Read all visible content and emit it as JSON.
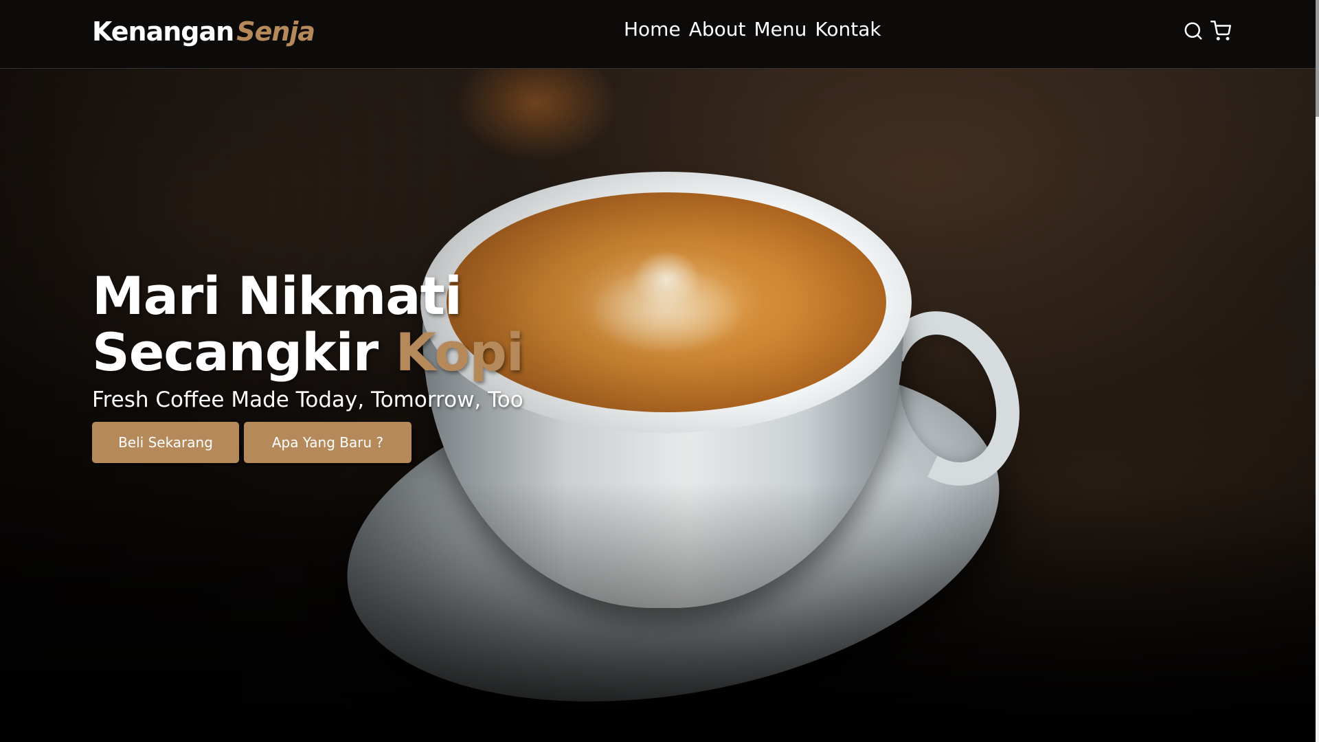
{
  "navbar": {
    "logo_part1": "Kenangan",
    "logo_part2": "Senja",
    "links": [
      "Home",
      "About",
      "Menu",
      "Kontak"
    ],
    "icons": [
      "search-icon",
      "cart-icon"
    ]
  },
  "hero": {
    "title_line1": "Mari Nikmati",
    "title_line2": "Secangkir",
    "title_accent": "Kopi",
    "subtitle": "Fresh Coffee Made Today, Tomorrow, Too",
    "buttons": {
      "buy_label": "Beli Sekarang",
      "new_label": "Apa Yang Baru ?"
    }
  },
  "colors": {
    "accent": "#b6895b",
    "navbar_bg": "#0d0b0a",
    "text": "#ffffff"
  }
}
